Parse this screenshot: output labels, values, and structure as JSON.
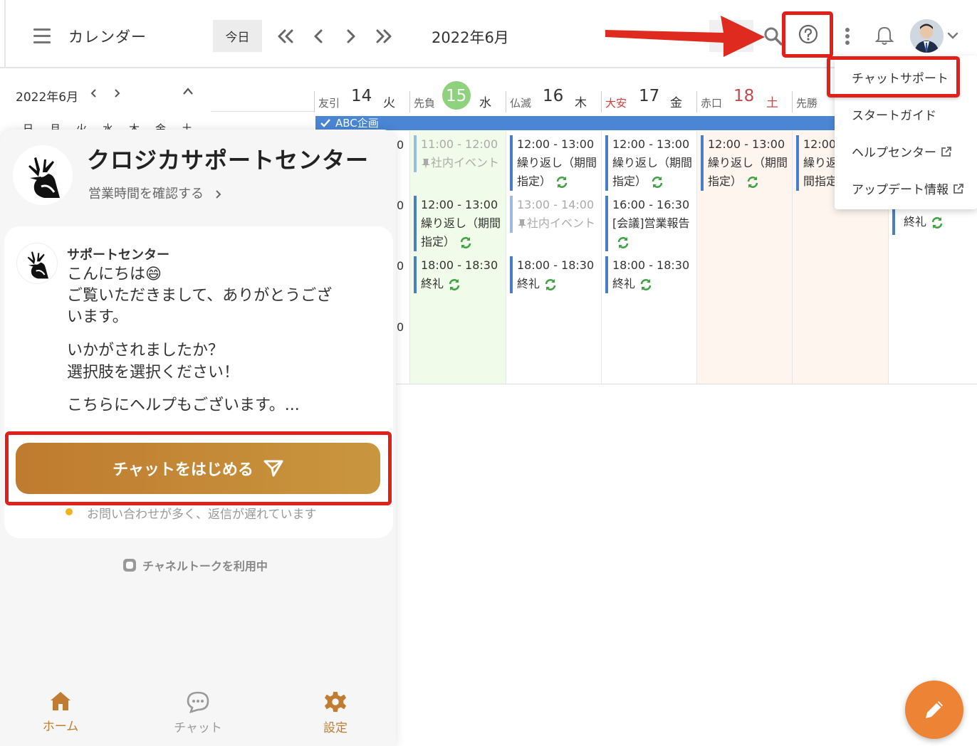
{
  "header": {
    "app_title": "カレンダー",
    "today_label": "今日",
    "current_month": "2022年6月"
  },
  "help_menu": {
    "items": [
      {
        "label": "チャットサポート",
        "external": false
      },
      {
        "label": "スタートガイド",
        "external": false
      },
      {
        "label": "ヘルプセンター",
        "external": true
      },
      {
        "label": "アップデート情報",
        "external": true
      }
    ]
  },
  "mini_calendar": {
    "title": "2022年6月",
    "weekdays": [
      "日",
      "月",
      "火",
      "水",
      "木",
      "金",
      "土"
    ]
  },
  "week": {
    "days": [
      {
        "rokuyo": "友引",
        "date": "14",
        "weekday": "火",
        "today": false,
        "rokuyo_color": "#666666",
        "date_color": "#333333"
      },
      {
        "rokuyo": "先負",
        "date": "15",
        "weekday": "水",
        "today": true,
        "rokuyo_color": "#666666",
        "date_color": "#ffffff"
      },
      {
        "rokuyo": "仏滅",
        "date": "16",
        "weekday": "木",
        "today": false,
        "rokuyo_color": "#666666",
        "date_color": "#333333"
      },
      {
        "rokuyo": "大安",
        "date": "17",
        "weekday": "金",
        "today": false,
        "rokuyo_color": "#d23b3b",
        "date_color": "#333333"
      },
      {
        "rokuyo": "赤口",
        "date": "18",
        "weekday": "土",
        "today": false,
        "rokuyo_color": "#666666",
        "date_color": "#c24a4a"
      },
      {
        "rokuyo": "先勝",
        "date": "",
        "weekday": "",
        "today": false,
        "rokuyo_color": "#666666",
        "date_color": "#333333"
      }
    ],
    "allday_event": "ABC企画",
    "left_hour_marks": [
      "0",
      "0",
      "0",
      "0"
    ],
    "events": {
      "d14": [
        {
          "time": "11:00 - 12:00",
          "title": "社内イベント",
          "pale": true
        },
        {
          "time": "12:00 - 13:00",
          "title": "繰り返し（期間指定）",
          "repeat": true
        },
        {
          "time": "18:00 - 18:30",
          "title": "終礼",
          "repeat": true
        }
      ],
      "d15": [
        {
          "time": "12:00 - 13:00",
          "title": "繰り返し（期間指定）",
          "repeat": true
        },
        {
          "time": "13:00 - 14:00",
          "title": "社内イベント",
          "pale": true
        },
        {
          "time": "18:00 - 18:30",
          "title": "終礼",
          "repeat": true
        }
      ],
      "d16": [
        {
          "time": "12:00 - 13:00",
          "title": "繰り返し（期間指定）",
          "repeat": true
        },
        {
          "time": "16:00 - 16:30",
          "title": "[会議]営業報告",
          "repeat": true
        },
        {
          "time": "18:00 - 18:30",
          "title": "終礼",
          "repeat": true
        }
      ],
      "d17": [
        {
          "time": "12:00 - 13:00",
          "title": "繰り返し（期間指定）",
          "repeat": true
        }
      ],
      "d18": [
        {
          "time": "12:00",
          "title": "繰り返",
          "title2": "間指定"
        }
      ],
      "d19": [
        {
          "time": "",
          "title": "終礼",
          "repeat": true
        }
      ]
    }
  },
  "chat": {
    "center_name": "クロジカサポートセンター",
    "hours_link": "営業時間を確認する",
    "sender": "サポートセンター",
    "messages": [
      "こんにちは😄",
      "ご覧いただきまして、ありがとうござ",
      "います。",
      "いかがされましたか？",
      "選択肢を選択ください！",
      "こちらにヘルプもございます。..."
    ],
    "start_button": "チャットをはじめる",
    "status": "お問い合わせが多く、返信が遅れています",
    "powered_by": "チャネルトークを利用中",
    "nav": [
      {
        "label": "ホーム",
        "icon": "home-icon",
        "active": true
      },
      {
        "label": "チャット",
        "icon": "chat-bubble-icon",
        "active": false
      },
      {
        "label": "設定",
        "icon": "gear-icon",
        "active": true
      }
    ]
  },
  "colors": {
    "accent_red": "#e0201b",
    "button_gold": "#c08434",
    "event_blue": "#4a7fc7",
    "today_green": "#8fd27e",
    "fab_orange": "#ec8335"
  }
}
